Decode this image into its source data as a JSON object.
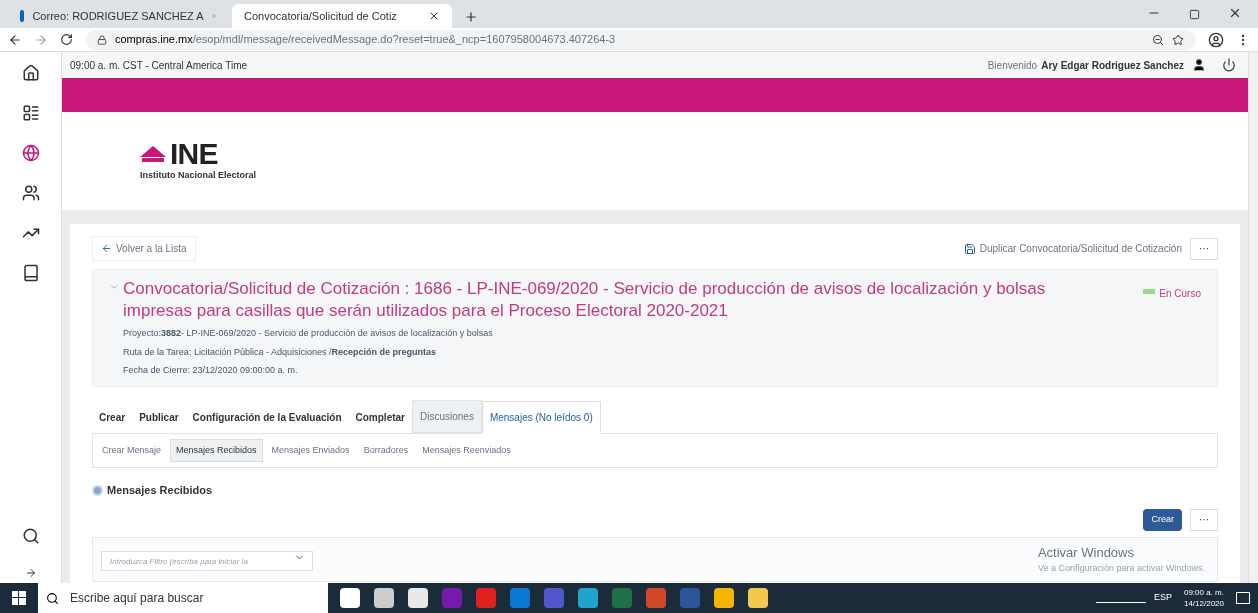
{
  "browser": {
    "tabs": [
      {
        "title": "Correo: RODRIGUEZ SANCHEZ A",
        "selected": false
      },
      {
        "title": "Convocatoria/Solicitud de Cotiz",
        "selected": true
      }
    ],
    "url_host": "compras.ine.mx",
    "url_path": "/esop/mdl/message/receivedMessage.do?reset=true&_ncp=1607958004673.407264-3"
  },
  "header": {
    "time": "09:00 a. m. CST - Central America Time",
    "welcome": "Bienvenido",
    "user": "Ary Edgar Rodriguez Sanchez"
  },
  "logo": {
    "mark": "INE",
    "name": "Instituto Nacional Electoral"
  },
  "toolbar": {
    "back": "Volver a la Lista",
    "duplicate": "Duplicar Convocatoria/Solicitud de Cotización",
    "more": "···"
  },
  "summary": {
    "title": "Convocatoria/Solicitud de Cotización : 1686 - LP-INE-069/2020 - Servicio de producción de avisos de localización y bolsas impresas para casillas que serán utilizados para el Proceso Electoral 2020-2021",
    "status": {
      "label": "En Curso",
      "color": "#9bd88f"
    },
    "lines": [
      "Proyecto:**3882**- LP-INE-069/2020 - Servicio de producción de avisos de localización y bolsas",
      "Ruta de la Tarea: Licitación Pública - Adquisiciones /**Recepción de preguntas**",
      "Fecha de Cierre: 23/12/2020 09:00:00 a. m."
    ]
  },
  "tabs": [
    {
      "label": "Crear",
      "kind": "link",
      "selected": false
    },
    {
      "label": "Publicar",
      "kind": "link",
      "selected": false
    },
    {
      "label": "Configuración de la Evaluación",
      "kind": "link",
      "selected": false
    },
    {
      "label": "Completar",
      "kind": "link",
      "selected": false
    },
    {
      "label": "Discusiones",
      "kind": "tab",
      "selected": false
    },
    {
      "label": "Mensajes (No leídos 0)",
      "kind": "tab",
      "selected": true
    }
  ],
  "subtabs": [
    {
      "label": "Crear Mensaje",
      "selected": false
    },
    {
      "label": "Mensajes Recibidos",
      "selected": true
    },
    {
      "label": "Mensajes Enviados",
      "selected": false
    },
    {
      "label": "Borradores",
      "selected": false
    },
    {
      "label": "Mensajes Reenviados",
      "selected": false
    }
  ],
  "section": {
    "title": "Mensajes Recibidos",
    "create": "Crear",
    "more": "···",
    "filter_placeholder": "Introduzca Filtro (escriba para iniciar la"
  },
  "activation": {
    "title": "Activar Windows",
    "subtitle": "Ve a Configuración para activar Windows."
  },
  "taskbar": {
    "search_placeholder": "Escribe aquí para buscar",
    "language": "ESP",
    "time": "09:00 a. m.",
    "date": "14/12/2020"
  }
}
